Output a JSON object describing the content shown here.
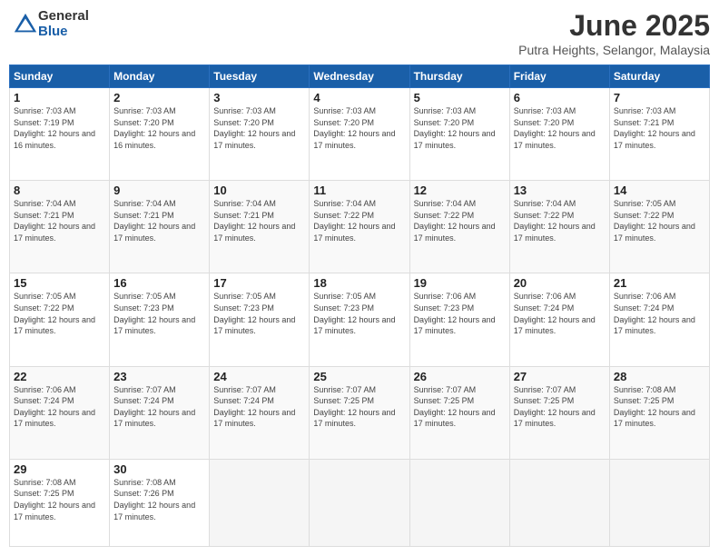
{
  "logo": {
    "general": "General",
    "blue": "Blue"
  },
  "title": "June 2025",
  "location": "Putra Heights, Selangor, Malaysia",
  "headers": [
    "Sunday",
    "Monday",
    "Tuesday",
    "Wednesday",
    "Thursday",
    "Friday",
    "Saturday"
  ],
  "weeks": [
    [
      {
        "day": "1",
        "sunrise": "7:03 AM",
        "sunset": "7:19 PM",
        "daylight": "12 hours and 16 minutes."
      },
      {
        "day": "2",
        "sunrise": "7:03 AM",
        "sunset": "7:20 PM",
        "daylight": "12 hours and 16 minutes."
      },
      {
        "day": "3",
        "sunrise": "7:03 AM",
        "sunset": "7:20 PM",
        "daylight": "12 hours and 17 minutes."
      },
      {
        "day": "4",
        "sunrise": "7:03 AM",
        "sunset": "7:20 PM",
        "daylight": "12 hours and 17 minutes."
      },
      {
        "day": "5",
        "sunrise": "7:03 AM",
        "sunset": "7:20 PM",
        "daylight": "12 hours and 17 minutes."
      },
      {
        "day": "6",
        "sunrise": "7:03 AM",
        "sunset": "7:20 PM",
        "daylight": "12 hours and 17 minutes."
      },
      {
        "day": "7",
        "sunrise": "7:03 AM",
        "sunset": "7:21 PM",
        "daylight": "12 hours and 17 minutes."
      }
    ],
    [
      {
        "day": "8",
        "sunrise": "7:04 AM",
        "sunset": "7:21 PM",
        "daylight": "12 hours and 17 minutes."
      },
      {
        "day": "9",
        "sunrise": "7:04 AM",
        "sunset": "7:21 PM",
        "daylight": "12 hours and 17 minutes."
      },
      {
        "day": "10",
        "sunrise": "7:04 AM",
        "sunset": "7:21 PM",
        "daylight": "12 hours and 17 minutes."
      },
      {
        "day": "11",
        "sunrise": "7:04 AM",
        "sunset": "7:22 PM",
        "daylight": "12 hours and 17 minutes."
      },
      {
        "day": "12",
        "sunrise": "7:04 AM",
        "sunset": "7:22 PM",
        "daylight": "12 hours and 17 minutes."
      },
      {
        "day": "13",
        "sunrise": "7:04 AM",
        "sunset": "7:22 PM",
        "daylight": "12 hours and 17 minutes."
      },
      {
        "day": "14",
        "sunrise": "7:05 AM",
        "sunset": "7:22 PM",
        "daylight": "12 hours and 17 minutes."
      }
    ],
    [
      {
        "day": "15",
        "sunrise": "7:05 AM",
        "sunset": "7:22 PM",
        "daylight": "12 hours and 17 minutes."
      },
      {
        "day": "16",
        "sunrise": "7:05 AM",
        "sunset": "7:23 PM",
        "daylight": "12 hours and 17 minutes."
      },
      {
        "day": "17",
        "sunrise": "7:05 AM",
        "sunset": "7:23 PM",
        "daylight": "12 hours and 17 minutes."
      },
      {
        "day": "18",
        "sunrise": "7:05 AM",
        "sunset": "7:23 PM",
        "daylight": "12 hours and 17 minutes."
      },
      {
        "day": "19",
        "sunrise": "7:06 AM",
        "sunset": "7:23 PM",
        "daylight": "12 hours and 17 minutes."
      },
      {
        "day": "20",
        "sunrise": "7:06 AM",
        "sunset": "7:24 PM",
        "daylight": "12 hours and 17 minutes."
      },
      {
        "day": "21",
        "sunrise": "7:06 AM",
        "sunset": "7:24 PM",
        "daylight": "12 hours and 17 minutes."
      }
    ],
    [
      {
        "day": "22",
        "sunrise": "7:06 AM",
        "sunset": "7:24 PM",
        "daylight": "12 hours and 17 minutes."
      },
      {
        "day": "23",
        "sunrise": "7:07 AM",
        "sunset": "7:24 PM",
        "daylight": "12 hours and 17 minutes."
      },
      {
        "day": "24",
        "sunrise": "7:07 AM",
        "sunset": "7:24 PM",
        "daylight": "12 hours and 17 minutes."
      },
      {
        "day": "25",
        "sunrise": "7:07 AM",
        "sunset": "7:25 PM",
        "daylight": "12 hours and 17 minutes."
      },
      {
        "day": "26",
        "sunrise": "7:07 AM",
        "sunset": "7:25 PM",
        "daylight": "12 hours and 17 minutes."
      },
      {
        "day": "27",
        "sunrise": "7:07 AM",
        "sunset": "7:25 PM",
        "daylight": "12 hours and 17 minutes."
      },
      {
        "day": "28",
        "sunrise": "7:08 AM",
        "sunset": "7:25 PM",
        "daylight": "12 hours and 17 minutes."
      }
    ],
    [
      {
        "day": "29",
        "sunrise": "7:08 AM",
        "sunset": "7:25 PM",
        "daylight": "12 hours and 17 minutes."
      },
      {
        "day": "30",
        "sunrise": "7:08 AM",
        "sunset": "7:26 PM",
        "daylight": "12 hours and 17 minutes."
      },
      null,
      null,
      null,
      null,
      null
    ]
  ],
  "labels": {
    "sunrise_prefix": "Sunrise: ",
    "sunset_prefix": "Sunset: ",
    "daylight_prefix": "Daylight: "
  }
}
